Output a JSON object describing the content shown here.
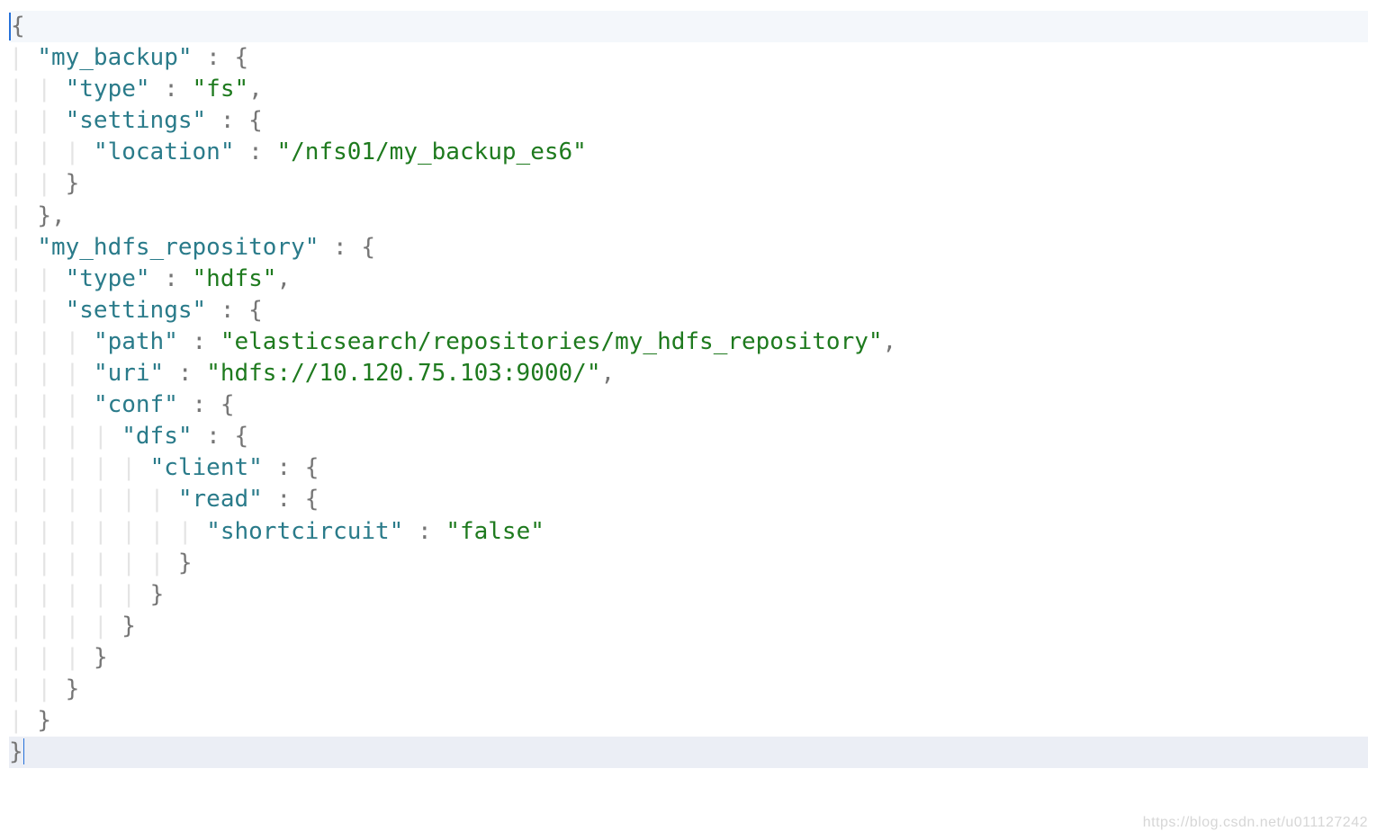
{
  "code": {
    "lines": [
      {
        "tokens": [
          {
            "t": "{",
            "c": "brace"
          }
        ],
        "highlight": "first",
        "leadingCursorBox": true
      },
      {
        "tokens": [
          {
            "t": "\"my_backup\"",
            "c": "key"
          },
          {
            "t": " : ",
            "c": "punct"
          },
          {
            "t": "{",
            "c": "brace"
          }
        ],
        "indent": 1
      },
      {
        "tokens": [
          {
            "t": "\"type\"",
            "c": "key"
          },
          {
            "t": " : ",
            "c": "punct"
          },
          {
            "t": "\"fs\"",
            "c": "string"
          },
          {
            "t": ",",
            "c": "punct"
          }
        ],
        "indent": 2
      },
      {
        "tokens": [
          {
            "t": "\"settings\"",
            "c": "key"
          },
          {
            "t": " : ",
            "c": "punct"
          },
          {
            "t": "{",
            "c": "brace"
          }
        ],
        "indent": 2
      },
      {
        "tokens": [
          {
            "t": "\"location\"",
            "c": "key"
          },
          {
            "t": " : ",
            "c": "punct"
          },
          {
            "t": "\"/nfs01/my_backup_es6\"",
            "c": "string"
          }
        ],
        "indent": 3
      },
      {
        "tokens": [
          {
            "t": "}",
            "c": "brace"
          }
        ],
        "indent": 2
      },
      {
        "tokens": [
          {
            "t": "}",
            "c": "brace"
          },
          {
            "t": ",",
            "c": "punct"
          }
        ],
        "indent": 1
      },
      {
        "tokens": [
          {
            "t": "\"my_hdfs_repository\"",
            "c": "key"
          },
          {
            "t": " : ",
            "c": "punct"
          },
          {
            "t": "{",
            "c": "brace"
          }
        ],
        "indent": 1
      },
      {
        "tokens": [
          {
            "t": "\"type\"",
            "c": "key"
          },
          {
            "t": " : ",
            "c": "punct"
          },
          {
            "t": "\"hdfs\"",
            "c": "string"
          },
          {
            "t": ",",
            "c": "punct"
          }
        ],
        "indent": 2
      },
      {
        "tokens": [
          {
            "t": "\"settings\"",
            "c": "key"
          },
          {
            "t": " : ",
            "c": "punct"
          },
          {
            "t": "{",
            "c": "brace"
          }
        ],
        "indent": 2
      },
      {
        "tokens": [
          {
            "t": "\"path\"",
            "c": "key"
          },
          {
            "t": " : ",
            "c": "punct"
          },
          {
            "t": "\"elasticsearch/repositories/my_hdfs_repository\"",
            "c": "string"
          },
          {
            "t": ",",
            "c": "punct"
          }
        ],
        "indent": 3
      },
      {
        "tokens": [
          {
            "t": "\"uri\"",
            "c": "key"
          },
          {
            "t": " : ",
            "c": "punct"
          },
          {
            "t": "\"hdfs://10.120.75.103:9000/\"",
            "c": "string"
          },
          {
            "t": ",",
            "c": "punct"
          }
        ],
        "indent": 3
      },
      {
        "tokens": [
          {
            "t": "\"conf\"",
            "c": "key"
          },
          {
            "t": " : ",
            "c": "punct"
          },
          {
            "t": "{",
            "c": "brace"
          }
        ],
        "indent": 3
      },
      {
        "tokens": [
          {
            "t": "\"dfs\"",
            "c": "key"
          },
          {
            "t": " : ",
            "c": "punct"
          },
          {
            "t": "{",
            "c": "brace"
          }
        ],
        "indent": 4
      },
      {
        "tokens": [
          {
            "t": "\"client\"",
            "c": "key"
          },
          {
            "t": " : ",
            "c": "punct"
          },
          {
            "t": "{",
            "c": "brace"
          }
        ],
        "indent": 5
      },
      {
        "tokens": [
          {
            "t": "\"read\"",
            "c": "key"
          },
          {
            "t": " : ",
            "c": "punct"
          },
          {
            "t": "{",
            "c": "brace"
          }
        ],
        "indent": 6
      },
      {
        "tokens": [
          {
            "t": "\"shortcircuit\"",
            "c": "key"
          },
          {
            "t": " : ",
            "c": "punct"
          },
          {
            "t": "\"false\"",
            "c": "string"
          }
        ],
        "indent": 7
      },
      {
        "tokens": [
          {
            "t": "}",
            "c": "brace"
          }
        ],
        "indent": 6
      },
      {
        "tokens": [
          {
            "t": "}",
            "c": "brace"
          }
        ],
        "indent": 5
      },
      {
        "tokens": [
          {
            "t": "}",
            "c": "brace"
          }
        ],
        "indent": 4
      },
      {
        "tokens": [
          {
            "t": "}",
            "c": "brace"
          }
        ],
        "indent": 3
      },
      {
        "tokens": [
          {
            "t": "}",
            "c": "brace"
          }
        ],
        "indent": 2
      },
      {
        "tokens": [
          {
            "t": "}",
            "c": "brace"
          }
        ],
        "indent": 1
      },
      {
        "tokens": [
          {
            "t": "}",
            "c": "brace"
          }
        ],
        "highlight": "last",
        "trailingCursor": true
      }
    ]
  },
  "watermark": "https://blog.csdn.net/u011127242"
}
